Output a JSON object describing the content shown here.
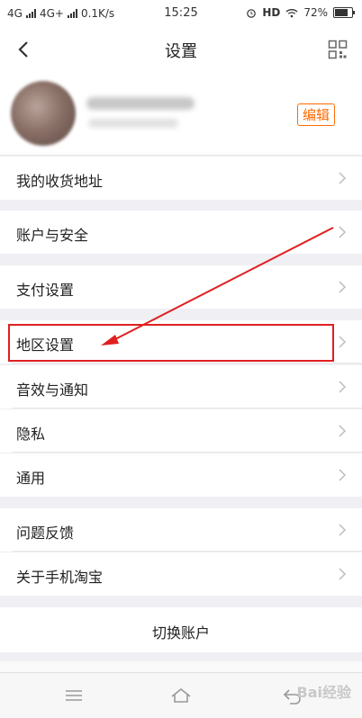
{
  "status_bar": {
    "network1": "4G",
    "network2": "4G+",
    "speed": "0.1K/s",
    "time": "15:25",
    "hd": "HD",
    "battery": "72%"
  },
  "nav": {
    "title": "设置"
  },
  "profile": {
    "edit_label": "编辑"
  },
  "menu": [
    {
      "label": "我的收货地址"
    },
    {
      "label": "账户与安全"
    },
    {
      "label": "支付设置"
    },
    {
      "label": "地区设置"
    },
    {
      "label": "音效与通知"
    },
    {
      "label": "隐私"
    },
    {
      "label": "通用"
    },
    {
      "label": "问题反馈"
    },
    {
      "label": "关于手机淘宝"
    }
  ],
  "switch_account": "切换账户",
  "watermark": "Bai经验",
  "colors": {
    "accent": "#ff6a00",
    "annotation": "#e02020",
    "background": "#efeff4"
  }
}
